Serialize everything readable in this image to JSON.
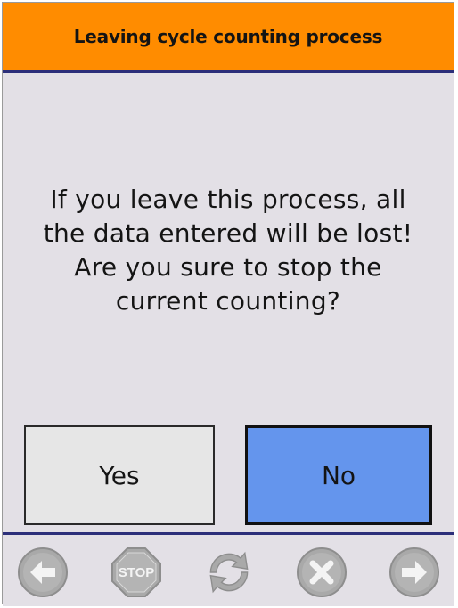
{
  "dialog": {
    "title": "Leaving cycle counting process",
    "message": "If you leave this process, all\nthe data entered will be lost!\nAre you sure to stop the\ncurrent counting?",
    "yes_label": "Yes",
    "no_label": "No"
  },
  "toolbar": {
    "icons": [
      "arrow-left-icon",
      "stop-icon",
      "refresh-icon",
      "close-icon",
      "arrow-right-icon"
    ],
    "stop_label": "STOP"
  },
  "colors": {
    "title_bar": "#ff8c00",
    "divider": "#2c2f7a",
    "background": "#e3e0e6",
    "no_button": "#6495ed",
    "yes_button": "#e6e6e6",
    "disabled_icon": "#a9a9a9"
  }
}
